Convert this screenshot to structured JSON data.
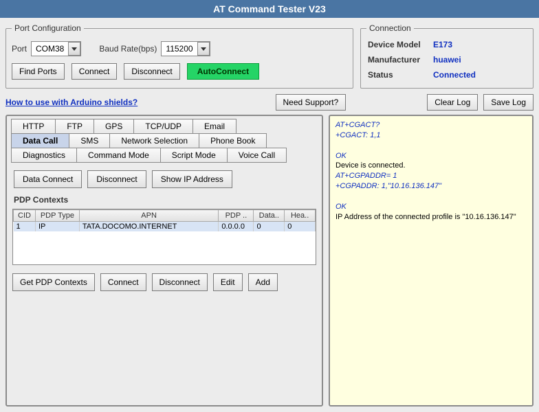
{
  "title": "AT Command Tester V23",
  "port_config": {
    "legend": "Port Configuration",
    "port_label": "Port",
    "port_value": "COM38",
    "baud_label": "Baud Rate(bps)",
    "baud_value": "115200",
    "find_ports": "Find Ports",
    "connect": "Connect",
    "disconnect": "Disconnect",
    "autoconnect": "AutoConnect"
  },
  "connection": {
    "legend": "Connection",
    "model_k": "Device Model",
    "model_v": "E173",
    "man_k": "Manufacturer",
    "man_v": "huawei",
    "status_k": "Status",
    "status_v": "Connected"
  },
  "links": {
    "arduino": "How to use with Arduino shields?",
    "need_support": "Need Support?",
    "clear_log": "Clear Log",
    "save_log": "Save Log"
  },
  "tabs_row1": [
    "HTTP",
    "FTP",
    "GPS",
    "TCP/UDP",
    "Email"
  ],
  "tabs_row2": [
    "Data Call",
    "SMS",
    "Network Selection",
    "Phone Book"
  ],
  "tabs_row3": [
    "Diagnostics",
    "Command Mode",
    "Script Mode",
    "Voice Call"
  ],
  "active_tab": "Data Call",
  "datacall": {
    "data_connect": "Data Connect",
    "disconnect": "Disconnect",
    "show_ip": "Show IP Address",
    "pdp_label": "PDP Contexts",
    "headers": [
      "CID",
      "PDP Type",
      "APN",
      "PDP ..",
      "Data..",
      "Hea.."
    ],
    "rows": [
      {
        "cid": "1",
        "type": "IP",
        "apn": "TATA.DOCOMO.INTERNET",
        "pdp": "0.0.0.0",
        "data": "0",
        "hea": "0"
      }
    ],
    "get_ctx": "Get PDP Contexts",
    "connect": "Connect",
    "disc": "Disconnect",
    "edit": "Edit",
    "add": "Add"
  },
  "log": [
    {
      "cls": "cmd",
      "t": "AT+CGACT?"
    },
    {
      "cls": "cmd",
      "t": "+CGACT: 1,1"
    },
    {
      "cls": "cmd",
      "t": ""
    },
    {
      "cls": "ok",
      "t": "OK"
    },
    {
      "cls": "txt",
      "t": "Device is connected."
    },
    {
      "cls": "cmd",
      "t": "AT+CGPADDR= 1"
    },
    {
      "cls": "cmd",
      "t": "+CGPADDR: 1,\"10.16.136.147\""
    },
    {
      "cls": "cmd",
      "t": ""
    },
    {
      "cls": "ok",
      "t": "OK"
    },
    {
      "cls": "txt",
      "t": "IP Address of the connected profile is \"10.16.136.147\""
    }
  ]
}
